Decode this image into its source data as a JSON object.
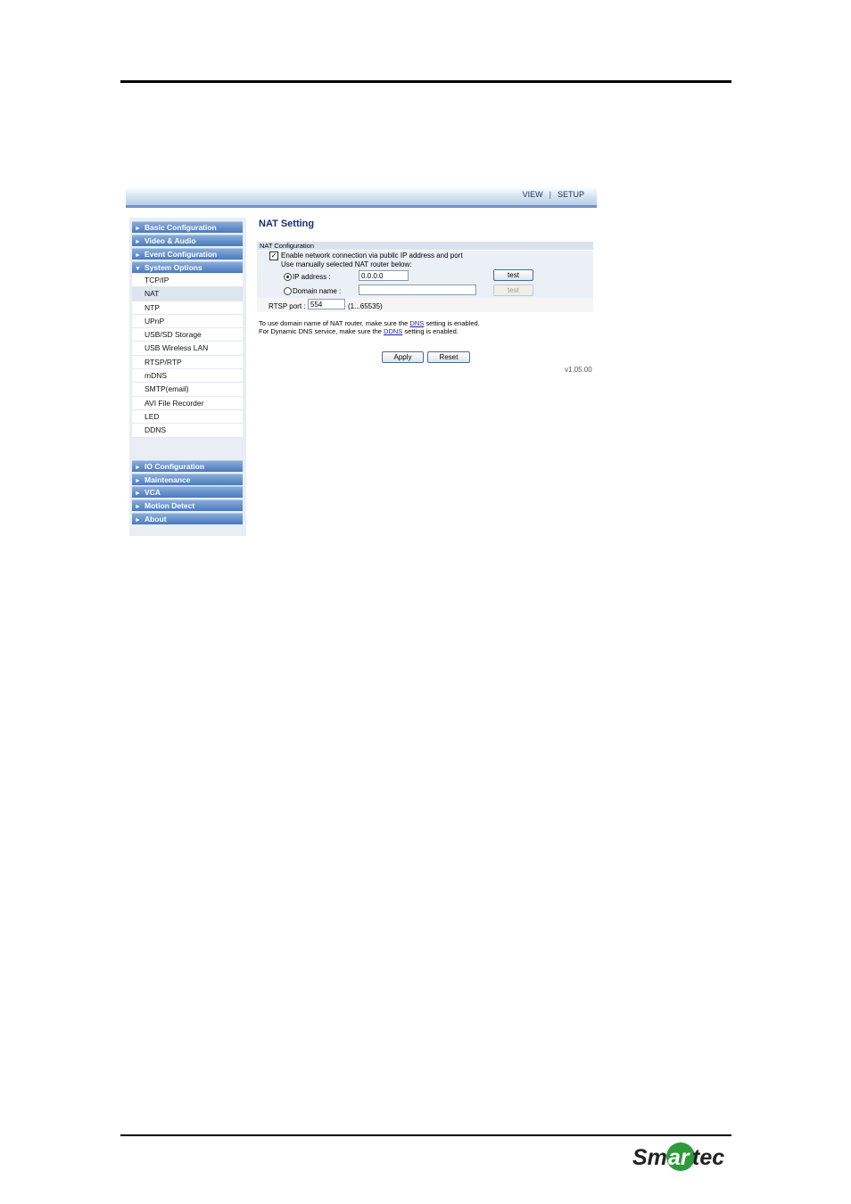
{
  "topnav": {
    "view": "VIEW",
    "sep": "|",
    "setup": "SETUP"
  },
  "sidebar": {
    "headers_top": [
      {
        "arrow": "►",
        "label": "Basic Configuration"
      },
      {
        "arrow": "►",
        "label": "Video & Audio"
      },
      {
        "arrow": "►",
        "label": "Event Configuration"
      },
      {
        "arrow": "▼",
        "label": "System Options"
      }
    ],
    "sub_items": [
      "TCP/IP",
      "NAT",
      "NTP",
      "UPnP",
      "USB/SD Storage",
      "USB Wireless LAN",
      "RTSP/RTP",
      "mDNS",
      "SMTP(email)",
      "AVI File Recorder",
      "LED",
      "DDNS"
    ],
    "active_sub": "NAT",
    "headers_bottom": [
      {
        "arrow": "►",
        "label": "IO Configuration"
      },
      {
        "arrow": "►",
        "label": "Maintenance"
      },
      {
        "arrow": "►",
        "label": "VCA"
      },
      {
        "arrow": "►",
        "label": "Motion Detect"
      },
      {
        "arrow": "►",
        "label": "About"
      }
    ]
  },
  "main": {
    "title": "NAT Setting",
    "section": "NAT Configuration",
    "enable_label": "Enable network connection via public IP address and port",
    "enable_checked": true,
    "manual_label": "Use manually selected NAT router below:",
    "ip_label": "IP address :",
    "ip_value": "0.0.0.0",
    "ip_selected": true,
    "domain_label": "Domain name :",
    "domain_value": "",
    "test_label": "test",
    "rtsp_label": "RTSP port :",
    "rtsp_value": "554",
    "rtsp_range": "(1...65535)",
    "note1_pre": "To use domain name of NAT router, make sure the ",
    "note1_link": "DNS",
    "note1_post": " setting is enabled.",
    "note2_pre": "For Dynamic DNS service, make sure the ",
    "note2_link": "DDNS",
    "note2_post": " setting is enabled.",
    "apply": "Apply",
    "reset": "Reset",
    "version": "v1.05.00"
  },
  "logo": {
    "text": "Smartec",
    "brand_green": "#2e9b3a"
  }
}
